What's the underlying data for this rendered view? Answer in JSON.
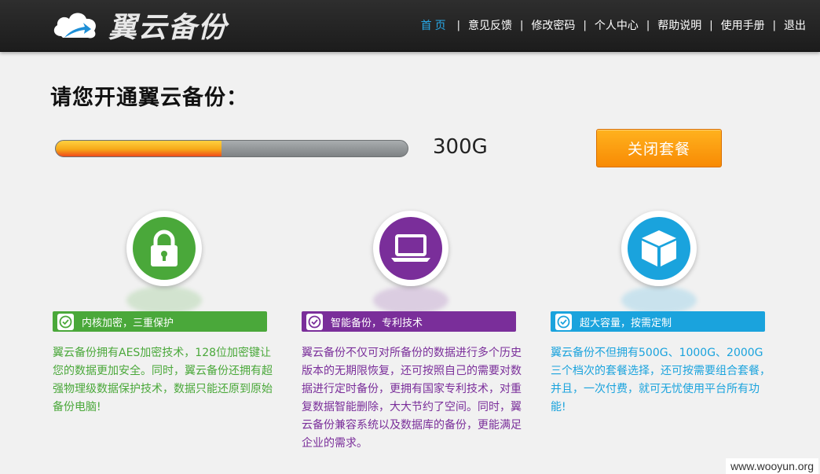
{
  "header": {
    "logo_text": "翼云备份",
    "nav": [
      {
        "label": "首页",
        "active": true
      },
      {
        "label": "意见反馈",
        "active": false
      },
      {
        "label": "修改密码",
        "active": false
      },
      {
        "label": "个人中心",
        "active": false
      },
      {
        "label": "帮助说明",
        "active": false
      },
      {
        "label": "使用手册",
        "active": false
      },
      {
        "label": "退出",
        "active": false
      }
    ],
    "nav_separator": "|"
  },
  "main": {
    "title": "请您开通翼云备份：",
    "progress": {
      "fraction": 0.47,
      "value_label": "300G"
    },
    "close_button_label": "关闭套餐"
  },
  "features": [
    {
      "icon": "lock-icon",
      "color": "#4aa83a",
      "bar_label": "内核加密，三重保护",
      "description": "翼云备份拥有AES加密技术，128位加密键让您的数据更加安全。同时，翼云备份还拥有超强物理级数据保护技术，数据只能还原到原始备份电脑!"
    },
    {
      "icon": "laptop-icon",
      "color": "#7a2e9a",
      "bar_label": "智能备份，专利技术",
      "description": "翼云备份不仅可对所备份的数据进行多个历史版本的无期限恢复，还可按照自己的需要对数据进行定时备份，更拥有国家专利技术，对重复数据智能删除，大大节约了空间。同时，翼云备份兼容系统以及数据库的备份，更能满足企业的需求。"
    },
    {
      "icon": "box-icon",
      "color": "#1aa3dd",
      "bar_label": "超大容量，按需定制",
      "description": "翼云备份不但拥有500G、1000G、2000G三个档次的套餐选择，还可按需要组合套餐，并且，一次付费，就可无忧使用平台所有功能!"
    }
  ],
  "watermark": "www.wooyun.org"
}
